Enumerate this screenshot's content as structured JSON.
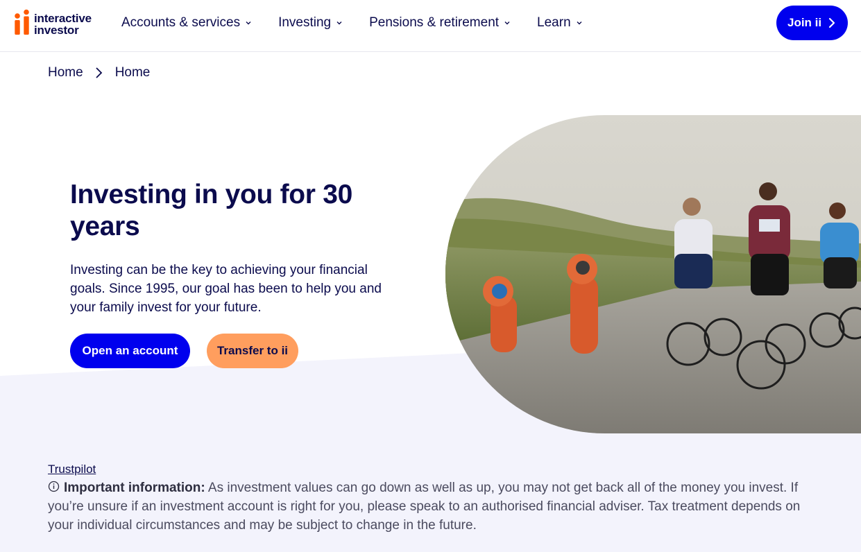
{
  "header": {
    "logo_line1": "interactive",
    "logo_line2": "investor",
    "nav": [
      {
        "label": "Accounts & services"
      },
      {
        "label": "Investing"
      },
      {
        "label": "Pensions & retirement"
      },
      {
        "label": "Learn"
      }
    ],
    "join_label": "Join ii"
  },
  "breadcrumb": [
    "Home",
    "Home"
  ],
  "hero": {
    "title": "Investing in you for 30 years",
    "description": "Investing can be the key to achieving your financial goals. Since 1995, our goal has been to help you and your family invest for your future.",
    "primary_button": "Open an account",
    "secondary_button": "Transfer to ii"
  },
  "footer": {
    "trustpilot": "Trustpilot",
    "info_heading": "Important information:",
    "info_text": " As investment values can go down as well as up, you may not get back all of the money you invest. If you’re unsure if an investment account is right for you, please speak to an authorised financial adviser. Tax treatment depends on your individual circumstances and may be subject to change in the future."
  },
  "colors": {
    "navy": "#0b0b4d",
    "brand_blue": "#0000ee",
    "orange": "#ff9e5e",
    "lavender_bg": "#f3f3fc",
    "logo_orange": "#ff5a00"
  }
}
